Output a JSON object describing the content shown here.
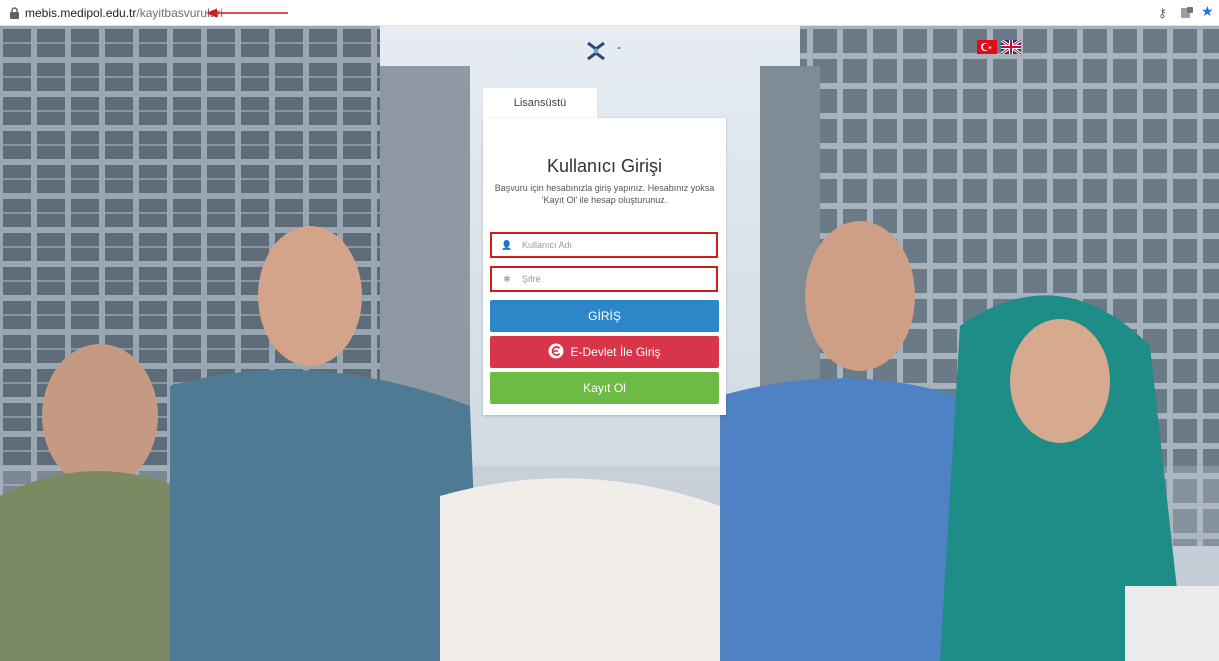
{
  "browser": {
    "url_host": "mebis.medipol.edu.tr",
    "url_path": "/kayitbasvurulari",
    "icons": [
      "lock-icon",
      "key-icon",
      "extension-icon",
      "star-icon"
    ]
  },
  "header": {
    "logo_icon": "university-logo",
    "logo_suffix": "-",
    "languages": [
      "tr-flag",
      "uk-flag"
    ]
  },
  "login": {
    "tab_label": "Lisansüstü",
    "title": "Kullanıcı Girişi",
    "subtitle": "Başvuru için hesabınızla giriş yapınız. Hesabınız yoksa 'Kayıt Ol' ile hesap oluşturunuz.",
    "username_placeholder": "Kullanıcı Adı",
    "password_placeholder": "Şifre",
    "login_label": "GİRİŞ",
    "edevlet_label": "E-Devlet İle Giriş",
    "register_label": "Kayıt Ol"
  },
  "colors": {
    "login_button": "#2d86c8",
    "edevlet_button": "#d9354a",
    "register_button": "#6dba45",
    "highlight_border": "#d11a1a"
  }
}
